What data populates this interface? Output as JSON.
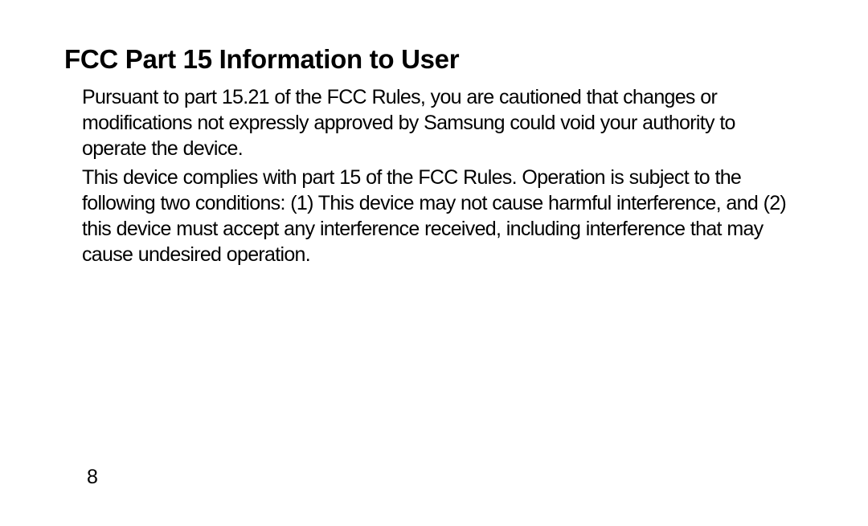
{
  "doc": {
    "heading": "FCC Part 15 Information to User",
    "paragraph1": "Pursuant to part 15.21 of the FCC Rules, you are cautioned that changes or modifications not expressly approved by Samsung could void your authority to operate the device.",
    "paragraph2": "This device complies with part 15 of the FCC Rules. Operation is subject to the following two conditions: (1) This device may not cause harmful interference, and (2) this device must accept any interference received, including interference that may cause undesired operation.",
    "page_number": "8"
  }
}
